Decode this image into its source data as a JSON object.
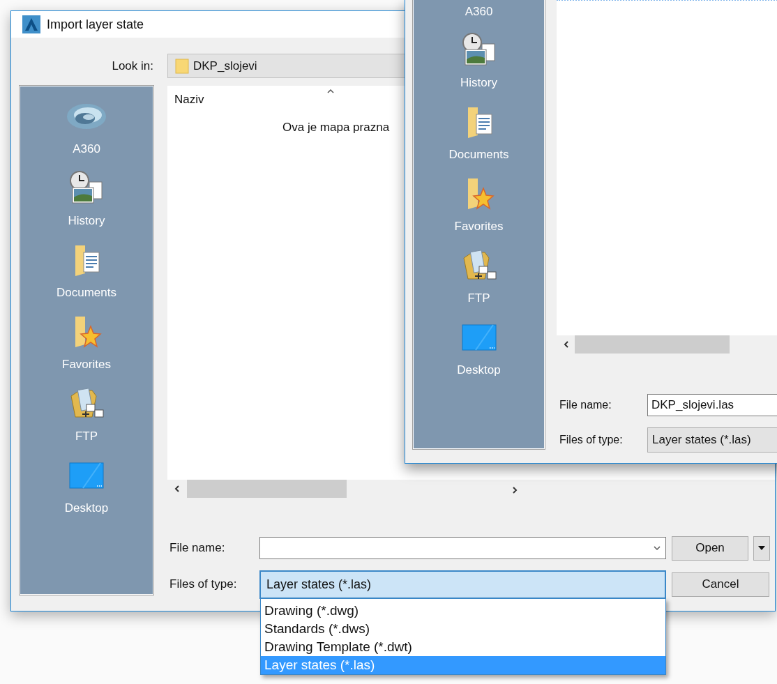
{
  "dialog": {
    "title": "Import layer state",
    "look_in": {
      "label": "Look in:",
      "value": "DKP_slojevi"
    },
    "places": [
      {
        "label": "A360",
        "kind": "cloud"
      },
      {
        "label": "History",
        "kind": "history"
      },
      {
        "label": "Documents",
        "kind": "documents"
      },
      {
        "label": "Favorites",
        "kind": "favorites"
      },
      {
        "label": "FTP",
        "kind": "ftp"
      },
      {
        "label": "Desktop",
        "kind": "desktop"
      }
    ],
    "file_list": {
      "column": "Naziv",
      "empty_message": "Ova je mapa prazna"
    },
    "file_name": {
      "label": "File name:"
    },
    "files_of_type": {
      "label": "Files of type:",
      "value": "Layer states (*.las)",
      "expanded": true,
      "options": [
        {
          "label": "Drawing (*.dwg)",
          "selected": false
        },
        {
          "label": "Standards (*.dws)",
          "selected": false
        },
        {
          "label": "Drawing Template (*.dwt)",
          "selected": false
        },
        {
          "label": "Layer states (*.las)",
          "selected": true
        }
      ]
    },
    "buttons": [
      {
        "label": "Open",
        "kind": "split"
      },
      {
        "label": "Cancel",
        "kind": "plain"
      }
    ]
  },
  "back_dialog": {
    "places": [
      {
        "label": "A360"
      },
      {
        "label": "History",
        "kind": "history"
      },
      {
        "label": "Documents",
        "kind": "documents"
      },
      {
        "label": "Favorites",
        "kind": "favorites"
      },
      {
        "label": "FTP",
        "kind": "ftp"
      },
      {
        "label": "Desktop",
        "kind": "desktop"
      }
    ],
    "file_name": {
      "label": "File name:",
      "value": "DKP_slojevi.las"
    },
    "files_of_type": {
      "label": "Files of type:",
      "value": "Layer states (*.las)"
    }
  }
}
